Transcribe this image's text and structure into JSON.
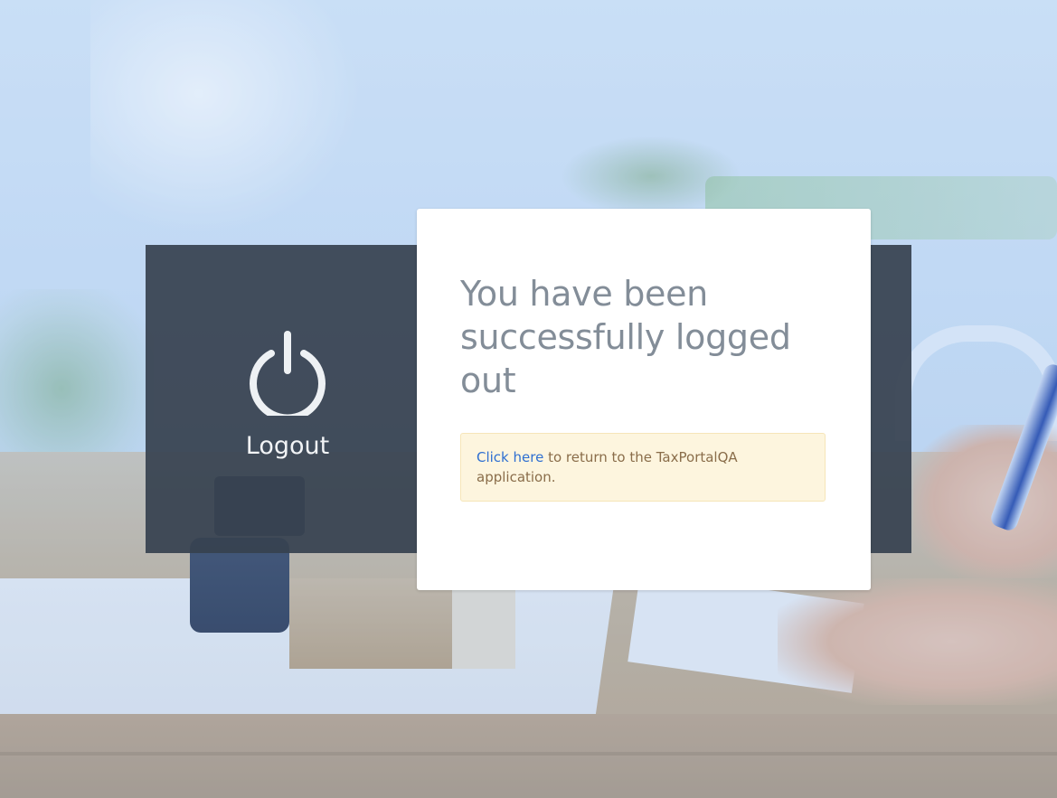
{
  "logout_panel": {
    "label": "Logout",
    "icon": "power-icon"
  },
  "card": {
    "title": "You have been successfully logged out",
    "message": {
      "link_text": "Click here",
      "text_after": " to return to the TaxPortalQA application."
    }
  },
  "colors": {
    "title": "#838d98",
    "link": "#2f6fd1",
    "alert_bg": "#fdf5de",
    "alert_text": "#8a6d4a",
    "dark_band": "#374250"
  }
}
